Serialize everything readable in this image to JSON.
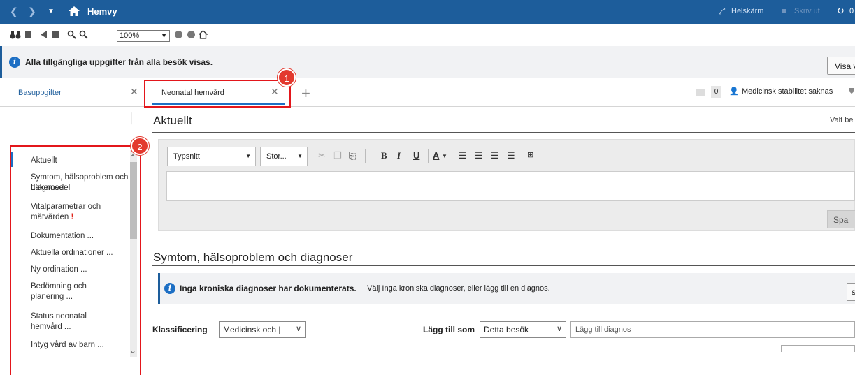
{
  "titlebar": {
    "title": "Hemvy",
    "fullscreen": "Helskärm",
    "print": "Skriv ut",
    "refresh_count": "0"
  },
  "toolbar": {
    "zoom": "100%"
  },
  "info": {
    "message": "Alla tillgängliga uppgifter från alla besök visas.",
    "button": "Visa v"
  },
  "tabs": [
    {
      "label": "Basuppgifter"
    },
    {
      "label": "Neonatal hemvård"
    }
  ],
  "right_tools": {
    "count": "0",
    "stability": "Medicinsk stabilitet saknas"
  },
  "sidebar": {
    "items": [
      {
        "label": "Aktuellt"
      },
      {
        "label": "Symtom, hälsoproblem och diagnoser"
      },
      {
        "label": "Läkemedel"
      },
      {
        "label": "Vitalparametrar och mätvärden"
      },
      {
        "label": "Dokumentation ..."
      },
      {
        "label": "Aktuella ordinationer ..."
      },
      {
        "label": "Ny ordination ..."
      },
      {
        "label": "Bedömning och planering ..."
      },
      {
        "label": "Status neonatal hemvård ..."
      },
      {
        "label": "Intyg vård av barn ..."
      }
    ]
  },
  "annotations": [
    "1",
    "2"
  ],
  "aktuellt": {
    "title": "Aktuellt",
    "valt": "Valt be",
    "font_select": "Typsnitt",
    "size_select": "Stor...",
    "save": "Spa"
  },
  "symtom": {
    "title": "Symtom, hälsoproblem och diagnoser",
    "info_bold": "Inga kroniska diagnoser har dokumenterats.",
    "info_rest": "Välj Inga kroniska diagnoser, eller lägg till en diagnos.",
    "info_btn": "s",
    "klass_label": "Klassificering",
    "klass_value": "Medicinsk och |",
    "lagg_label": "Lägg till som",
    "lagg_value": "Detta besök",
    "diag_placeholder": "Lägg till diagnos"
  },
  "colors": {
    "titlebar": "#1d5d9b",
    "accent": "#1d6fc4",
    "annotation": "#e3161b"
  }
}
